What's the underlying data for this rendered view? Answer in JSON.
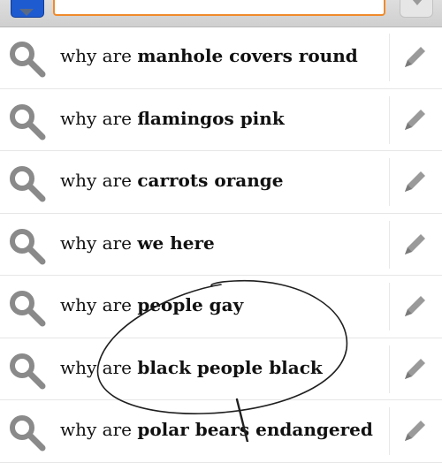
{
  "search": {
    "engine_icon": "blue-search-engine-icon",
    "input_value": ""
  },
  "suggestions": [
    {
      "prefix": "why are ",
      "completion": "manhole covers round"
    },
    {
      "prefix": "why are ",
      "completion": "flamingos pink"
    },
    {
      "prefix": "why are ",
      "completion": "carrots orange"
    },
    {
      "prefix": "why are ",
      "completion": "we here"
    },
    {
      "prefix": "why are ",
      "completion": "people gay"
    },
    {
      "prefix": "why are ",
      "completion": "black people black"
    },
    {
      "prefix": "why are ",
      "completion": "polar bears endangered"
    }
  ],
  "colors": {
    "input_border": "#f08a2b",
    "engine_icon": "#1e5bd1",
    "icon_gray": "#8a8a8a",
    "scribble": "#1f1f1f"
  },
  "icons": {
    "row_left": "search-icon",
    "row_right": "pencil-icon"
  }
}
